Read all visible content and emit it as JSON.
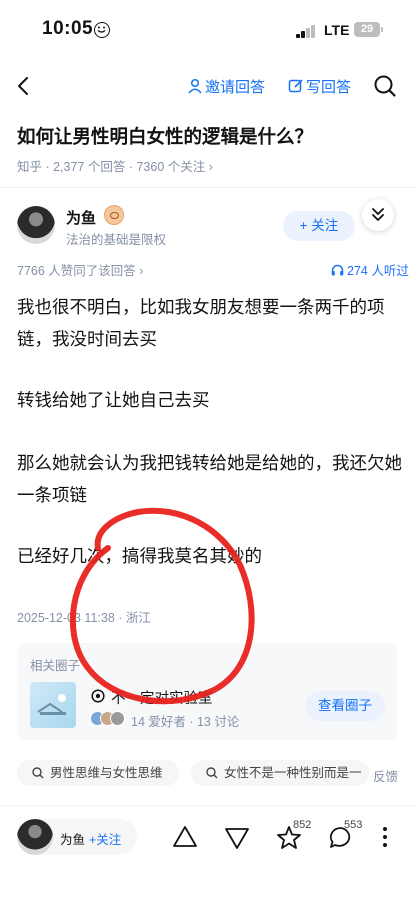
{
  "status": {
    "time": "10:05",
    "network": "LTE",
    "battery": "29"
  },
  "nav": {
    "invite": "邀请回答",
    "write": "写回答"
  },
  "question": {
    "title": "如何让男性明白女性的逻辑是什么？",
    "meta": "知乎 · 2,377 个回答 · 7360 个关注 ›"
  },
  "answer": {
    "author": "为鱼",
    "bio": "法治的基础是限权",
    "follow": "+ 关注",
    "agree": "7766 人赞同了该回答 ›",
    "listen": "274 人听过",
    "paragraphs": [
      "我也很不明白，比如我女朋友想要一条两千的项链，我没时间去买",
      "转钱给她了让她自己去买",
      "那么她就会认为我把钱转给她是给她的，我还欠她一条项链",
      "已经好几次，搞得我莫名其妙的"
    ],
    "date": "2025-12-03 11:38 · 浙江"
  },
  "circle": {
    "section_title": "相关圈子",
    "name": "不一定对实验室",
    "stats": "14 爱好者 · 13 讨论",
    "button": "查看圈子"
  },
  "tags": [
    "男性思维与女性思维",
    "女性不是一种性别而是一"
  ],
  "feedback": "反馈",
  "bottom": {
    "author": "为鱼",
    "follow": "+关注",
    "like_count": "852",
    "comment_count": "553"
  },
  "colors": {
    "accent": "#1772f6",
    "annotation": "#e8231f"
  }
}
